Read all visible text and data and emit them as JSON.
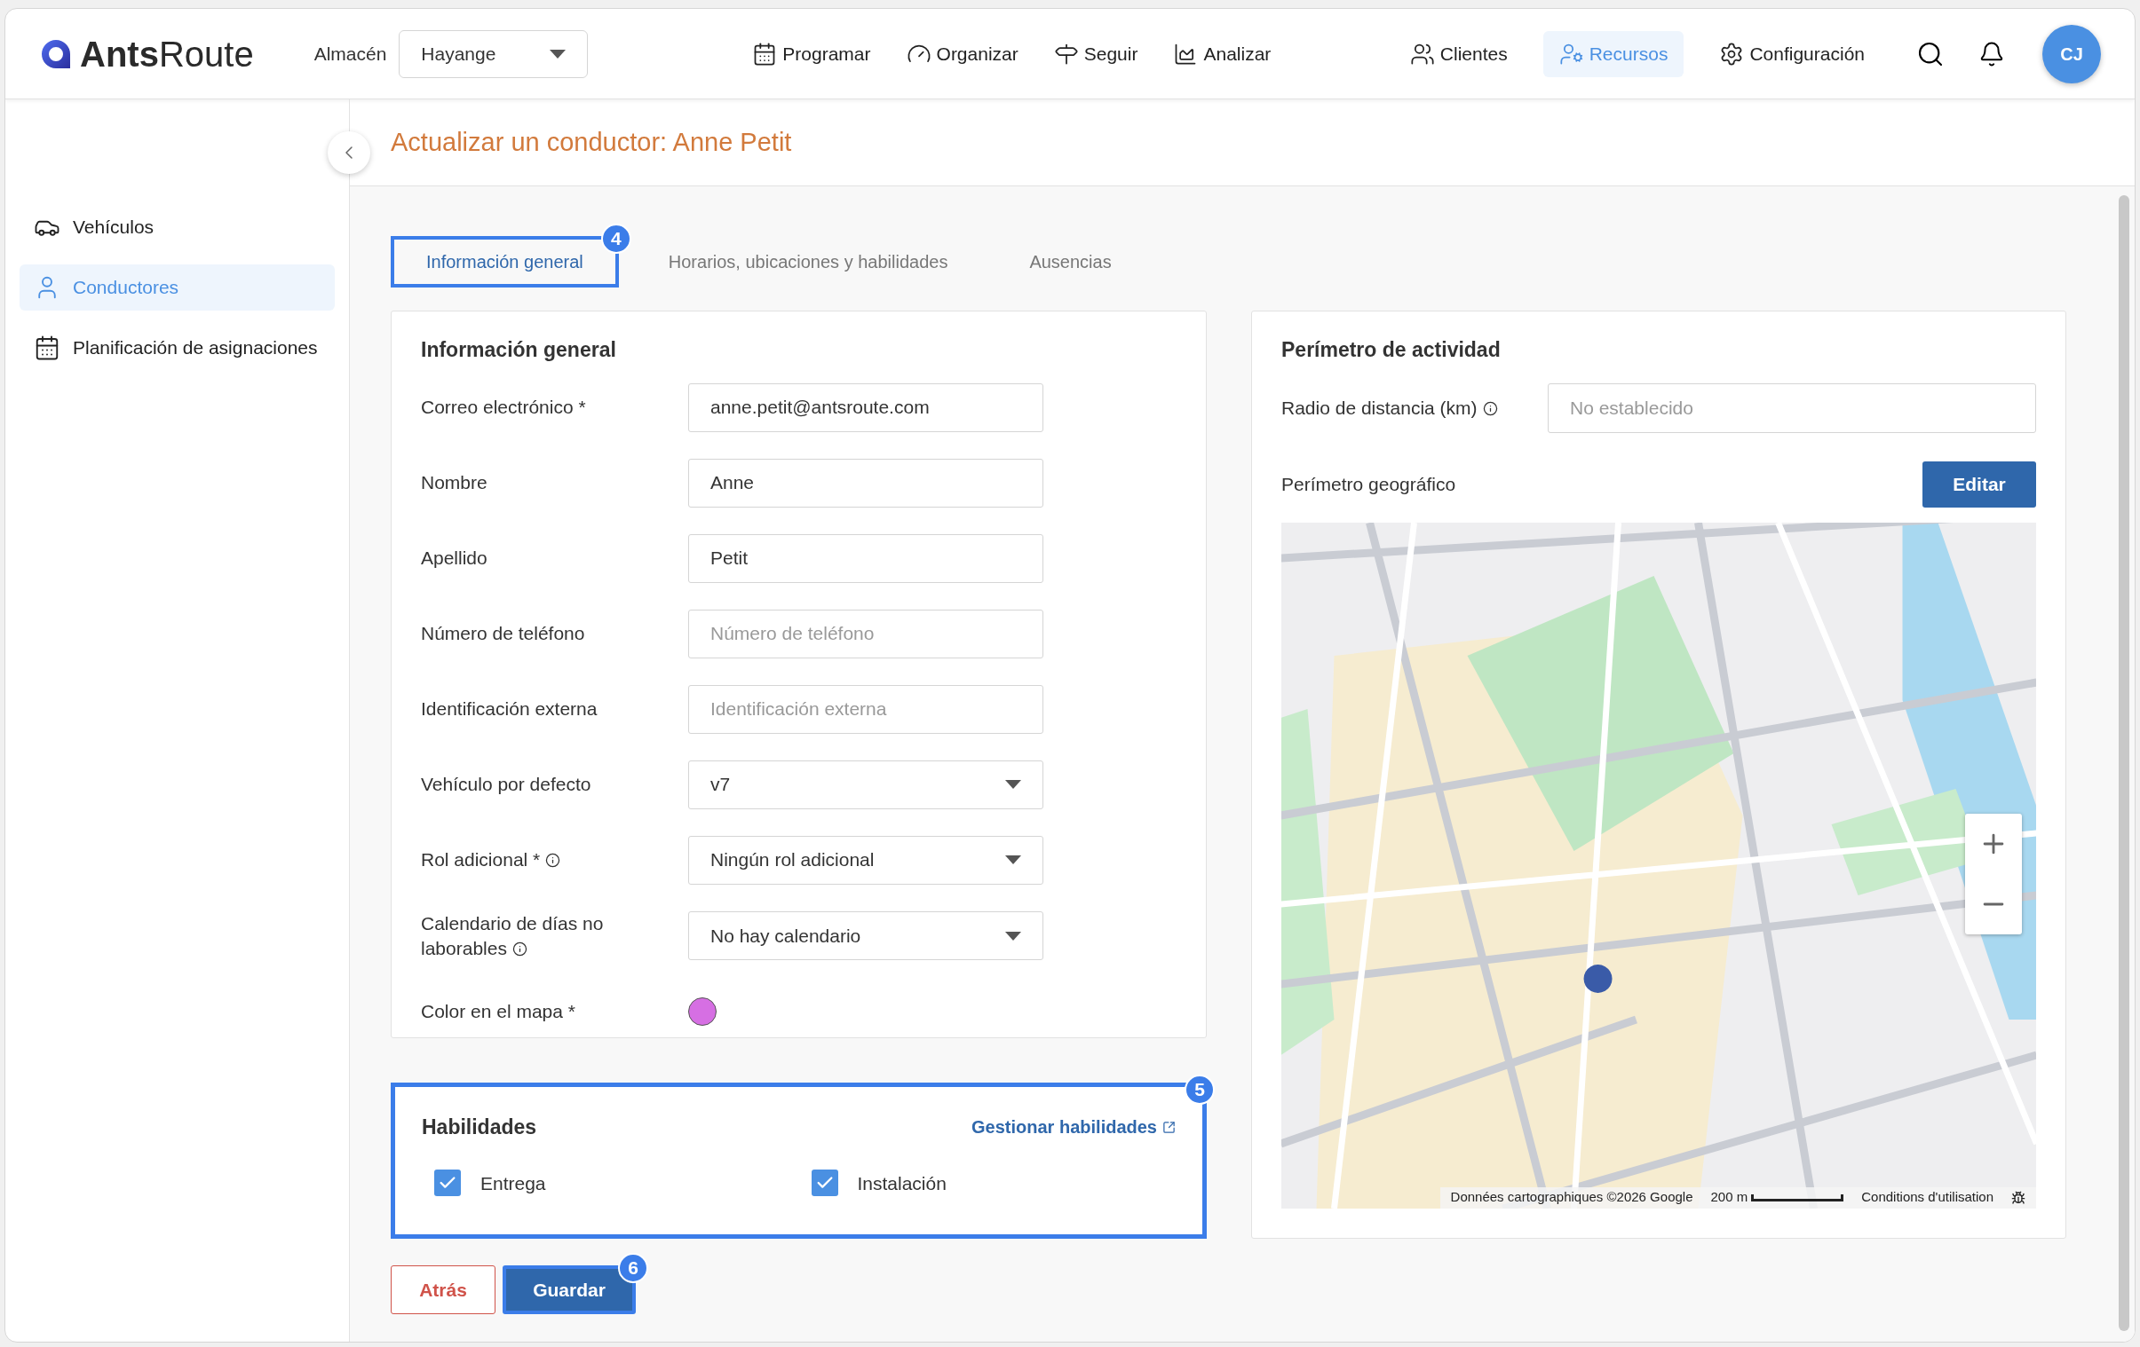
{
  "header": {
    "logo": {
      "bold": "Ants",
      "light": "Route"
    },
    "warehouse": {
      "label": "Almacén",
      "value": "Hayange"
    },
    "nav": [
      {
        "label": "Programar"
      },
      {
        "label": "Organizar"
      },
      {
        "label": "Seguir"
      },
      {
        "label": "Analizar"
      }
    ],
    "right_nav": [
      {
        "label": "Clientes",
        "selected": false
      },
      {
        "label": "Recursos",
        "selected": true
      },
      {
        "label": "Configuración",
        "selected": false
      }
    ],
    "avatar": "CJ"
  },
  "sidebar": {
    "items": [
      {
        "label": "Vehículos",
        "selected": false
      },
      {
        "label": "Conductores",
        "selected": true
      },
      {
        "label": "Planificación de asignaciones",
        "selected": false
      }
    ]
  },
  "page_title": "Actualizar un conductor: Anne Petit",
  "tabs": [
    {
      "label": "Información general",
      "selected": true,
      "badge": "4"
    },
    {
      "label": "Horarios, ubicaciones y habilidades",
      "selected": false
    },
    {
      "label": "Ausencias",
      "selected": false
    }
  ],
  "general": {
    "title": "Información general",
    "fields": [
      {
        "kind": "text",
        "label": "Correo electrónico *",
        "value": "anne.petit@antsroute.com"
      },
      {
        "kind": "text",
        "label": "Nombre",
        "value": "Anne"
      },
      {
        "kind": "text",
        "label": "Apellido",
        "value": "Petit"
      },
      {
        "kind": "text",
        "label": "Número de teléfono",
        "placeholder": "Número de teléfono"
      },
      {
        "kind": "text",
        "label": "Identificación externa",
        "placeholder": "Identificación externa"
      },
      {
        "kind": "select",
        "label": "Vehículo por defecto",
        "value": "v7"
      },
      {
        "kind": "select",
        "label": "Rol adicional *",
        "info": true,
        "value": "Ningún rol adicional"
      },
      {
        "kind": "select",
        "label": "Calendario de días no laborables",
        "info": true,
        "value": "No hay calendario"
      },
      {
        "kind": "color",
        "label": "Color en el mapa *",
        "color": "#d66fe3"
      }
    ]
  },
  "skills": {
    "title": "Habilidades",
    "badge": "5",
    "link": "Gestionar habilidades",
    "items": [
      {
        "label": "Entrega",
        "checked": true
      },
      {
        "label": "Instalación",
        "checked": true
      }
    ]
  },
  "buttons": [
    {
      "kind": "secondary",
      "label": "Atrás"
    },
    {
      "kind": "primary",
      "label": "Guardar",
      "badge": "6"
    }
  ],
  "activity": {
    "title": "Perímetro de actividad",
    "radius": {
      "label": "Radio de distancia (km)",
      "info": true,
      "placeholder": "No establecido"
    },
    "geo": {
      "label": "Perímetro geográfico",
      "button": "Editar"
    },
    "map": {
      "attribution": "Données cartographiques ©2026 Google",
      "scale": "200 m",
      "terms": "Conditions d'utilisation"
    }
  }
}
